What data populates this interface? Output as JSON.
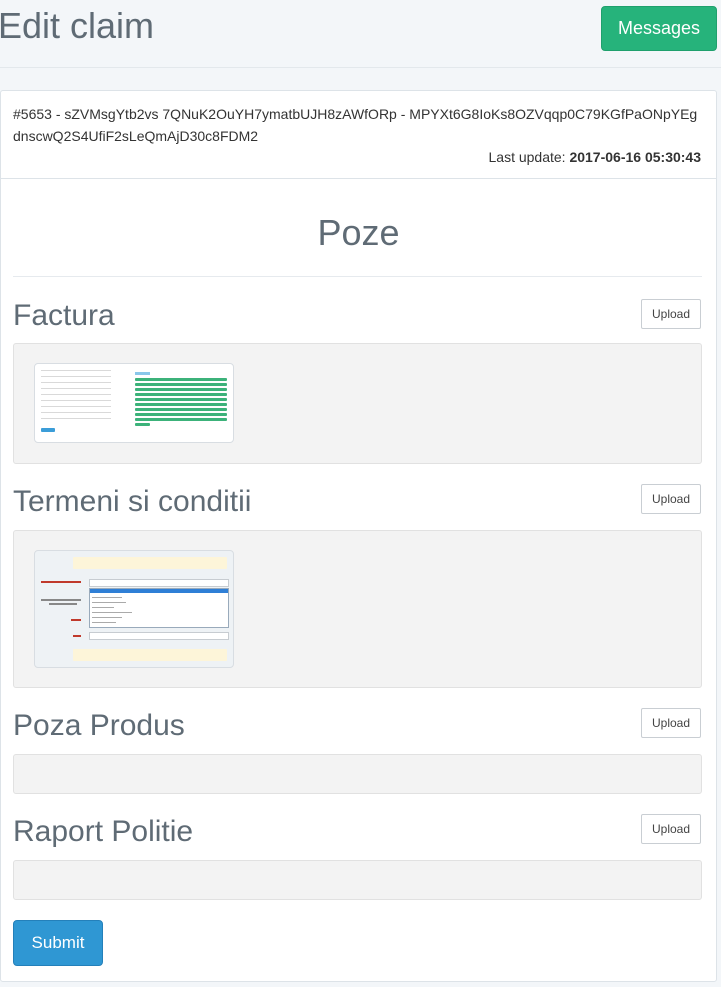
{
  "header": {
    "title": "Edit claim",
    "messages_button": "Messages"
  },
  "claim": {
    "id_line": "#5653 - sZVMsgYtb2vs 7QNuK2OuYH7ymatbUJH8zAWfORp - MPYXt6G8IoKs8OZVqqp0C79KGfPaONpYEgdnscwQ2S4UfiF2sLeQmAjD30c8FDM2",
    "last_update_label": "Last update:",
    "last_update_value": "2017-06-16 05:30:43"
  },
  "section": {
    "title": "Poze"
  },
  "categories": [
    {
      "title": "Factura",
      "upload_label": "Upload",
      "has_image": true
    },
    {
      "title": "Termeni si conditii",
      "upload_label": "Upload",
      "has_image": true
    },
    {
      "title": "Poza Produs",
      "upload_label": "Upload",
      "has_image": false
    },
    {
      "title": "Raport Politie",
      "upload_label": "Upload",
      "has_image": false
    }
  ],
  "submit_label": "Submit",
  "colors": {
    "messages_button": "#26b37b",
    "submit_button": "#2f97d3",
    "background": "#f3f6f9"
  }
}
